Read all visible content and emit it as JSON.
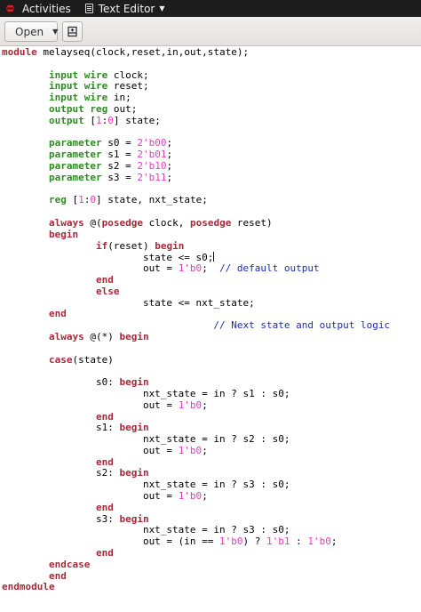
{
  "topbar": {
    "activities_label": "Activities",
    "app_name": "Text Editor",
    "logo_icon": "fedora-logo-icon",
    "app_icon": "text-editor-icon",
    "menu_icon": "chevron-down-icon"
  },
  "toolbar": {
    "open_label": "Open",
    "open_arrow_icon": "chevron-down-icon",
    "new_document_icon": "new-document-icon"
  },
  "colors": {
    "keyword_green": "#2e8b22",
    "keyword_maroon": "#a52a3a",
    "number": "#e23bbf",
    "comment": "#1a2fb0"
  },
  "code_lines": [
    [
      {
        "t": "module",
        "c": "kw-maroon"
      },
      {
        "t": " melayseq(clock,reset,in,out,state);"
      }
    ],
    [],
    [
      {
        "t": "        "
      },
      {
        "t": "input wire",
        "c": "kw-green"
      },
      {
        "t": " clock;"
      }
    ],
    [
      {
        "t": "        "
      },
      {
        "t": "input wire",
        "c": "kw-green"
      },
      {
        "t": " reset;"
      }
    ],
    [
      {
        "t": "        "
      },
      {
        "t": "input wire",
        "c": "kw-green"
      },
      {
        "t": " in;"
      }
    ],
    [
      {
        "t": "        "
      },
      {
        "t": "output reg",
        "c": "kw-green"
      },
      {
        "t": " out;"
      }
    ],
    [
      {
        "t": "        "
      },
      {
        "t": "output",
        "c": "kw-green"
      },
      {
        "t": " ["
      },
      {
        "t": "1",
        "c": "num"
      },
      {
        "t": ":"
      },
      {
        "t": "0",
        "c": "num"
      },
      {
        "t": "] state;"
      }
    ],
    [],
    [
      {
        "t": "        "
      },
      {
        "t": "parameter",
        "c": "kw-green"
      },
      {
        "t": " s0 = "
      },
      {
        "t": "2'b00",
        "c": "num"
      },
      {
        "t": ";"
      }
    ],
    [
      {
        "t": "        "
      },
      {
        "t": "parameter",
        "c": "kw-green"
      },
      {
        "t": " s1 = "
      },
      {
        "t": "2'b01",
        "c": "num"
      },
      {
        "t": ";"
      }
    ],
    [
      {
        "t": "        "
      },
      {
        "t": "parameter",
        "c": "kw-green"
      },
      {
        "t": " s2 = "
      },
      {
        "t": "2'b10",
        "c": "num"
      },
      {
        "t": ";"
      }
    ],
    [
      {
        "t": "        "
      },
      {
        "t": "parameter",
        "c": "kw-green"
      },
      {
        "t": " s3 = "
      },
      {
        "t": "2'b11",
        "c": "num"
      },
      {
        "t": ";"
      }
    ],
    [],
    [
      {
        "t": "        "
      },
      {
        "t": "reg",
        "c": "kw-green"
      },
      {
        "t": " ["
      },
      {
        "t": "1",
        "c": "num"
      },
      {
        "t": ":"
      },
      {
        "t": "0",
        "c": "num"
      },
      {
        "t": "] state, nxt_state;"
      }
    ],
    [],
    [
      {
        "t": "        "
      },
      {
        "t": "always",
        "c": "kw-maroon"
      },
      {
        "t": " @("
      },
      {
        "t": "posedge",
        "c": "kw-maroon"
      },
      {
        "t": " clock, "
      },
      {
        "t": "posedge",
        "c": "kw-maroon"
      },
      {
        "t": " reset)"
      }
    ],
    [
      {
        "t": "        "
      },
      {
        "t": "begin",
        "c": "kw-maroon"
      }
    ],
    [
      {
        "t": "                "
      },
      {
        "t": "if",
        "c": "kw-maroon"
      },
      {
        "t": "(reset) "
      },
      {
        "t": "begin",
        "c": "kw-maroon"
      }
    ],
    [
      {
        "t": "                        state <= s0;"
      },
      {
        "caret": true
      }
    ],
    [
      {
        "t": "                        out = "
      },
      {
        "t": "1'b0",
        "c": "num"
      },
      {
        "t": ";  "
      },
      {
        "t": "// default output",
        "c": "comment"
      }
    ],
    [
      {
        "t": "                "
      },
      {
        "t": "end",
        "c": "kw-maroon"
      }
    ],
    [
      {
        "t": "                "
      },
      {
        "t": "else",
        "c": "kw-maroon"
      }
    ],
    [
      {
        "t": "                        state <= nxt_state;"
      }
    ],
    [
      {
        "t": "        "
      },
      {
        "t": "end",
        "c": "kw-maroon"
      }
    ],
    [
      {
        "t": "                                    "
      },
      {
        "t": "// Next state and output logic",
        "c": "comment"
      }
    ],
    [
      {
        "t": "        "
      },
      {
        "t": "always",
        "c": "kw-maroon"
      },
      {
        "t": " @(*) "
      },
      {
        "t": "begin",
        "c": "kw-maroon"
      }
    ],
    [],
    [
      {
        "t": "        "
      },
      {
        "t": "case",
        "c": "kw-maroon"
      },
      {
        "t": "(state)"
      }
    ],
    [],
    [
      {
        "t": "                s0: "
      },
      {
        "t": "begin",
        "c": "kw-maroon"
      }
    ],
    [
      {
        "t": "                        nxt_state = in ? s1 : s0;"
      }
    ],
    [
      {
        "t": "                        out = "
      },
      {
        "t": "1'b0",
        "c": "num"
      },
      {
        "t": ";"
      }
    ],
    [
      {
        "t": "                "
      },
      {
        "t": "end",
        "c": "kw-maroon"
      }
    ],
    [
      {
        "t": "                s1: "
      },
      {
        "t": "begin",
        "c": "kw-maroon"
      }
    ],
    [
      {
        "t": "                        nxt_state = in ? s2 : s0;"
      }
    ],
    [
      {
        "t": "                        out = "
      },
      {
        "t": "1'b0",
        "c": "num"
      },
      {
        "t": ";"
      }
    ],
    [
      {
        "t": "                "
      },
      {
        "t": "end",
        "c": "kw-maroon"
      }
    ],
    [
      {
        "t": "                s2: "
      },
      {
        "t": "begin",
        "c": "kw-maroon"
      }
    ],
    [
      {
        "t": "                        nxt_state = in ? s3 : s0;"
      }
    ],
    [
      {
        "t": "                        out = "
      },
      {
        "t": "1'b0",
        "c": "num"
      },
      {
        "t": ";"
      }
    ],
    [
      {
        "t": "                "
      },
      {
        "t": "end",
        "c": "kw-maroon"
      }
    ],
    [
      {
        "t": "                s3: "
      },
      {
        "t": "begin",
        "c": "kw-maroon"
      }
    ],
    [
      {
        "t": "                        nxt_state = in ? s3 : s0;"
      }
    ],
    [
      {
        "t": "                        out = (in == "
      },
      {
        "t": "1'b0",
        "c": "num"
      },
      {
        "t": ") ? "
      },
      {
        "t": "1'b1",
        "c": "num"
      },
      {
        "t": " : "
      },
      {
        "t": "1'b0",
        "c": "num"
      },
      {
        "t": ";"
      }
    ],
    [
      {
        "t": "                "
      },
      {
        "t": "end",
        "c": "kw-maroon"
      }
    ],
    [
      {
        "t": "        "
      },
      {
        "t": "endcase",
        "c": "kw-maroon"
      }
    ],
    [
      {
        "t": "        "
      },
      {
        "t": "end",
        "c": "kw-maroon"
      }
    ],
    [
      {
        "t": "endmodule",
        "c": "kw-maroon"
      }
    ]
  ]
}
